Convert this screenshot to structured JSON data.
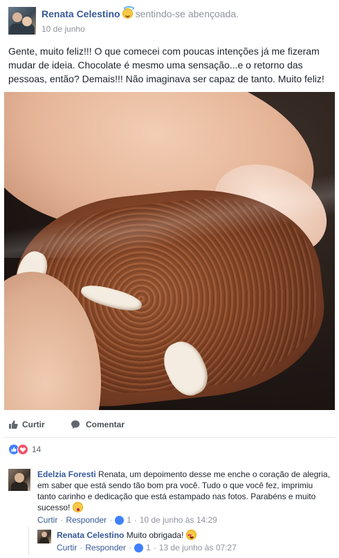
{
  "post": {
    "author": "Renata Celestino",
    "feeling": "sentindo-se abençoada.",
    "feeling_icon": "halo-smiley-icon",
    "date": "10 de junho",
    "text": "Gente, muito feliz!!! O que comecei com poucas intenções já me fizeram mudar de ideia. Chocolate é mesmo uma sensação...e o retorno das pessoas, então? Demais!!! Não imaginava ser capaz de tanto. Muito feliz!"
  },
  "actions": {
    "like_label": "Curtir",
    "comment_label": "Comentar"
  },
  "reactions": {
    "types": [
      "like",
      "love"
    ],
    "count": "14"
  },
  "comments": [
    {
      "author": "Edelzia Foresti",
      "text": "Renata, um depoimento desse me enche o coração de alegria, em saber que está sendo tão bom pra você. Tudo o que você fez, imprimiu tanto carinho e dedicação que está estampado nas fotos. Parabéns e muito sucesso!",
      "emoji": "kissing-face-icon",
      "like_label": "Curtir",
      "reply_label": "Responder",
      "likes": "1",
      "timestamp": "10 de junho às 14:29"
    },
    {
      "author": "Renata Celestino",
      "text": "Muito obrigada!",
      "emoji": "heart-eyes-face-icon",
      "like_label": "Curtir",
      "reply_label": "Responder",
      "likes": "1",
      "timestamp": "13 de junho às 07:27"
    }
  ],
  "colors": {
    "link_blue": "#365899",
    "meta_gray": "#90949c",
    "like_blue": "#4080ff",
    "love_red": "#f25268"
  }
}
